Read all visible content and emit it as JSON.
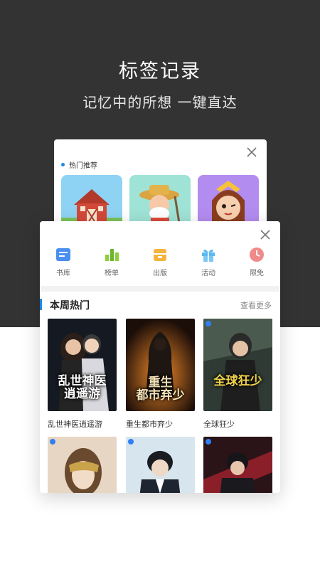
{
  "intro": {
    "title": "标签记录",
    "subtitle": "记忆中的所想 一键直达"
  },
  "back_card": {
    "section_title": "热门推荐"
  },
  "front_card": {
    "categories": [
      {
        "label": "书库",
        "icon": "library-icon",
        "color": "#4a8ff0"
      },
      {
        "label": "榜单",
        "icon": "ranking-icon",
        "color": "#8bcf3e"
      },
      {
        "label": "出版",
        "icon": "publish-icon",
        "color": "#f5b33d"
      },
      {
        "label": "活动",
        "icon": "gift-icon",
        "color": "#5bb8f0"
      },
      {
        "label": "限免",
        "icon": "clock-icon",
        "color": "#f08a8a"
      }
    ],
    "section": {
      "title": "本周热门",
      "more": "查看更多"
    },
    "books": [
      {
        "name": "乱世神医逍遥游",
        "cover_text": "乱世神医\n逍遥游"
      },
      {
        "name": "重生都市弃少",
        "cover_text": "重生\n都市弃少"
      },
      {
        "name": "全球狂少",
        "cover_text": "全球狂少"
      },
      {
        "name": "",
        "cover_text": ""
      },
      {
        "name": "",
        "cover_text": ""
      },
      {
        "name": "",
        "cover_text": ""
      }
    ]
  },
  "colors": {
    "top_background": "#333333",
    "accent": "#1e88e5"
  }
}
